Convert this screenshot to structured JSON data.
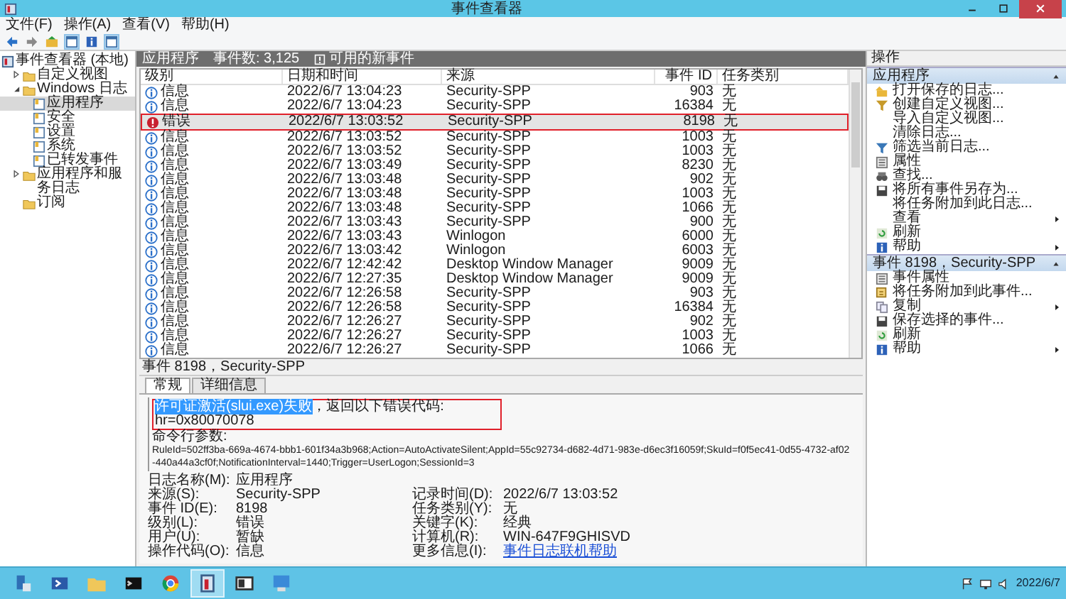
{
  "window": {
    "title": "事件查看器"
  },
  "menu": [
    "文件(F)",
    "操作(A)",
    "查看(V)",
    "帮助(H)"
  ],
  "tree": {
    "label": "事件查看器 (本地)",
    "selected": false,
    "children": [
      {
        "label": "自定义视图",
        "selected": false,
        "expanded": false
      },
      {
        "label": "Windows 日志",
        "selected": false,
        "expanded": true,
        "children": [
          {
            "label": "应用程序",
            "selected": true
          },
          {
            "label": "安全",
            "selected": false
          },
          {
            "label": "设置",
            "selected": false
          },
          {
            "label": "系统",
            "selected": false
          },
          {
            "label": "已转发事件",
            "selected": false
          }
        ]
      },
      {
        "label": "应用程序和服务日志",
        "selected": false,
        "expanded": false
      },
      {
        "label": "订阅",
        "selected": false
      }
    ]
  },
  "log_header": {
    "title": "应用程序",
    "count": "事件数: 3,125",
    "notice": "可用的新事件"
  },
  "table": {
    "columns": [
      "级别",
      "日期和时间",
      "来源",
      "事件 ID",
      "任务类别"
    ],
    "rows": [
      {
        "kind": "info",
        "level": "信息",
        "time": "2022/6/7 13:04:23",
        "source": "Security-SPP",
        "id": "903",
        "task": "无",
        "selected": false,
        "annotated": false
      },
      {
        "kind": "info",
        "level": "信息",
        "time": "2022/6/7 13:04:23",
        "source": "Security-SPP",
        "id": "16384",
        "task": "无",
        "selected": false,
        "annotated": false
      },
      {
        "kind": "error",
        "level": "错误",
        "time": "2022/6/7 13:03:52",
        "source": "Security-SPP",
        "id": "8198",
        "task": "无",
        "selected": true,
        "annotated": true
      },
      {
        "kind": "info",
        "level": "信息",
        "time": "2022/6/7 13:03:52",
        "source": "Security-SPP",
        "id": "1003",
        "task": "无",
        "selected": false,
        "annotated": false
      },
      {
        "kind": "info",
        "level": "信息",
        "time": "2022/6/7 13:03:52",
        "source": "Security-SPP",
        "id": "1003",
        "task": "无",
        "selected": false,
        "annotated": false
      },
      {
        "kind": "info",
        "level": "信息",
        "time": "2022/6/7 13:03:49",
        "source": "Security-SPP",
        "id": "8230",
        "task": "无",
        "selected": false,
        "annotated": false
      },
      {
        "kind": "info",
        "level": "信息",
        "time": "2022/6/7 13:03:48",
        "source": "Security-SPP",
        "id": "902",
        "task": "无",
        "selected": false,
        "annotated": false
      },
      {
        "kind": "info",
        "level": "信息",
        "time": "2022/6/7 13:03:48",
        "source": "Security-SPP",
        "id": "1003",
        "task": "无",
        "selected": false,
        "annotated": false
      },
      {
        "kind": "info",
        "level": "信息",
        "time": "2022/6/7 13:03:48",
        "source": "Security-SPP",
        "id": "1066",
        "task": "无",
        "selected": false,
        "annotated": false
      },
      {
        "kind": "info",
        "level": "信息",
        "time": "2022/6/7 13:03:43",
        "source": "Security-SPP",
        "id": "900",
        "task": "无",
        "selected": false,
        "annotated": false
      },
      {
        "kind": "info",
        "level": "信息",
        "time": "2022/6/7 13:03:43",
        "source": "Winlogon",
        "id": "6000",
        "task": "无",
        "selected": false,
        "annotated": false
      },
      {
        "kind": "info",
        "level": "信息",
        "time": "2022/6/7 13:03:42",
        "source": "Winlogon",
        "id": "6003",
        "task": "无",
        "selected": false,
        "annotated": false
      },
      {
        "kind": "info",
        "level": "信息",
        "time": "2022/6/7 12:42:42",
        "source": "Desktop Window Manager",
        "id": "9009",
        "task": "无",
        "selected": false,
        "annotated": false
      },
      {
        "kind": "info",
        "level": "信息",
        "time": "2022/6/7 12:27:35",
        "source": "Desktop Window Manager",
        "id": "9009",
        "task": "无",
        "selected": false,
        "annotated": false
      },
      {
        "kind": "info",
        "level": "信息",
        "time": "2022/6/7 12:26:58",
        "source": "Security-SPP",
        "id": "903",
        "task": "无",
        "selected": false,
        "annotated": false
      },
      {
        "kind": "info",
        "level": "信息",
        "time": "2022/6/7 12:26:58",
        "source": "Security-SPP",
        "id": "16384",
        "task": "无",
        "selected": false,
        "annotated": false
      },
      {
        "kind": "info",
        "level": "信息",
        "time": "2022/6/7 12:26:27",
        "source": "Security-SPP",
        "id": "902",
        "task": "无",
        "selected": false,
        "annotated": false
      },
      {
        "kind": "info",
        "level": "信息",
        "time": "2022/6/7 12:26:27",
        "source": "Security-SPP",
        "id": "1003",
        "task": "无",
        "selected": false,
        "annotated": false
      },
      {
        "kind": "info",
        "level": "信息",
        "time": "2022/6/7 12:26:27",
        "source": "Security-SPP",
        "id": "1066",
        "task": "无",
        "selected": false,
        "annotated": false
      }
    ]
  },
  "detail": {
    "title": "事件 8198，Security-SPP",
    "tabs": [
      {
        "label": "常规",
        "selected": true
      },
      {
        "label": "详细信息",
        "selected": false
      }
    ],
    "framed_lines": [
      {
        "selected_part": "许可证激活(slui.exe)失败",
        "text": "，返回以下错误代码:"
      },
      {
        "text": "hr=0x80070078"
      }
    ],
    "lines": [
      "命令行参数:",
      "RuleId=502ff3ba-669a-4674-bbb1-601f34a3b968;Action=AutoActivateSilent;AppId=55c92734-d682-4d71-983e-d6ec3f16059f;SkuId=f0f5ec41-0d55-4732-af02-440a44a3cf0f;NotificationInterval=1440;Trigger=UserLogon;SessionId=3"
    ],
    "fields": [
      [
        {
          "label": "日志名称(M):",
          "value": "应用程序"
        }
      ],
      [
        {
          "label": "来源(S):",
          "value": "Security-SPP"
        },
        {
          "label": "记录时间(D):",
          "value": "2022/6/7 13:03:52"
        }
      ],
      [
        {
          "label": "事件 ID(E):",
          "value": "8198"
        },
        {
          "label": "任务类别(Y):",
          "value": "无"
        }
      ],
      [
        {
          "label": "级别(L):",
          "value": "错误"
        },
        {
          "label": "关键字(K):",
          "value": "经典"
        }
      ],
      [
        {
          "label": "用户(U):",
          "value": "暂缺"
        },
        {
          "label": "计算机(R):",
          "value": "WIN-647F9GHISVD"
        }
      ],
      [
        {
          "label": "操作代码(O):",
          "value": "信息"
        },
        {
          "label": "更多信息(I):",
          "link": "事件日志联机帮助"
        }
      ]
    ]
  },
  "actions": {
    "title": "操作",
    "sections": [
      {
        "title": "应用程序",
        "items": [
          {
            "label": "打开保存的日志...",
            "submenu": false
          },
          {
            "label": "创建自定义视图...",
            "submenu": false
          },
          {
            "label": "导入自定义视图...",
            "submenu": false
          },
          {
            "label": "清除日志...",
            "submenu": false
          },
          {
            "label": "筛选当前日志...",
            "submenu": false
          },
          {
            "label": "属性",
            "submenu": false
          },
          {
            "label": "查找...",
            "submenu": false
          },
          {
            "label": "将所有事件另存为...",
            "submenu": false
          },
          {
            "label": "将任务附加到此日志...",
            "submenu": false
          },
          {
            "label": "查看",
            "submenu": true
          },
          {
            "label": "刷新",
            "submenu": false
          },
          {
            "label": "帮助",
            "submenu": true
          }
        ]
      },
      {
        "title": "事件 8198，Security-SPP",
        "items": [
          {
            "label": "事件属性",
            "submenu": false
          },
          {
            "label": "将任务附加到此事件...",
            "submenu": false
          },
          {
            "label": "复制",
            "submenu": true
          },
          {
            "label": "保存选择的事件...",
            "submenu": false
          },
          {
            "label": "刷新",
            "submenu": false
          },
          {
            "label": "帮助",
            "submenu": true
          }
        ]
      }
    ]
  },
  "taskbar": {
    "apps": [
      {
        "selected": false
      },
      {
        "selected": false
      },
      {
        "selected": false
      },
      {
        "selected": false
      },
      {
        "selected": false
      },
      {
        "selected": true
      },
      {
        "selected": false
      },
      {
        "selected": false
      }
    ],
    "date": "2022/6/7"
  }
}
